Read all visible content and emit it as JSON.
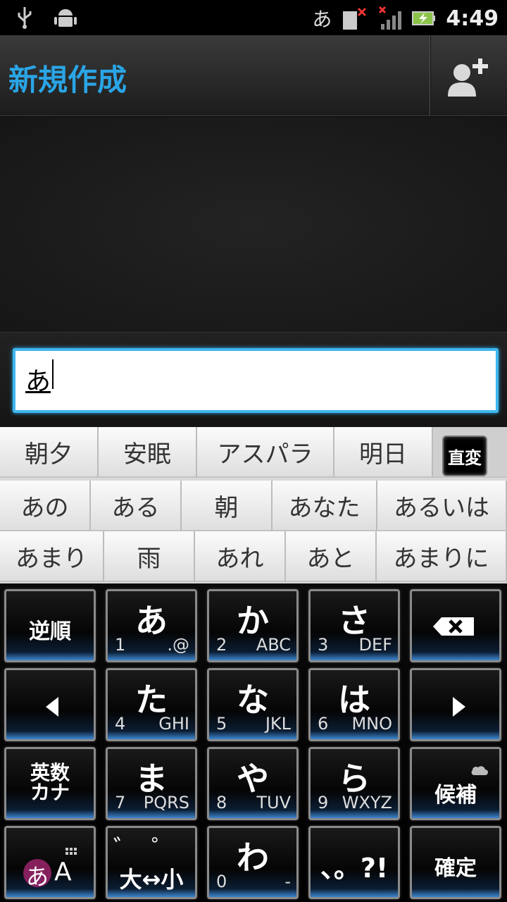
{
  "status_bar": {
    "ime": "あ",
    "time": "4:49",
    "icons": [
      "usb-icon",
      "android-debug-icon",
      "no-sim-icon",
      "no-signal-icon",
      "battery-charging-icon"
    ]
  },
  "title_bar": {
    "title": "新規作成",
    "add_contact_icon": "add-contact-icon"
  },
  "compose": {
    "input_value": "あ"
  },
  "candidates": {
    "row1": [
      "朝夕",
      "安眠",
      "アスパラ",
      "明日"
    ],
    "convert_button": "直変",
    "row2": [
      "あの",
      "ある",
      "朝",
      "あなた",
      "あるいは"
    ],
    "row3": [
      "あまり",
      "雨",
      "あれ",
      "あと",
      "あまりに"
    ]
  },
  "keyboard": {
    "reverse": "逆順",
    "keys": [
      {
        "main": "あ",
        "num": "1",
        "sub": ".@"
      },
      {
        "main": "か",
        "num": "2",
        "sub": "ABC"
      },
      {
        "main": "さ",
        "num": "3",
        "sub": "DEF"
      },
      {
        "main": "た",
        "num": "4",
        "sub": "GHI"
      },
      {
        "main": "な",
        "num": "5",
        "sub": "JKL"
      },
      {
        "main": "は",
        "num": "6",
        "sub": "MNO"
      },
      {
        "main": "ま",
        "num": "7",
        "sub": "PQRS"
      },
      {
        "main": "や",
        "num": "8",
        "sub": "TUV"
      },
      {
        "main": "ら",
        "num": "9",
        "sub": "WXYZ"
      },
      {
        "main": "わ",
        "num": "0",
        "sub": "-"
      }
    ],
    "alnum_kana_line1": "英数",
    "alnum_kana_line2": "カナ",
    "candidates_key": "候補",
    "mode_key_kana": "あ",
    "mode_key_alpha": "A",
    "dakuten": "゛゜",
    "size_toggle": "大↔小",
    "punct": "、。?!",
    "confirm": "確定"
  },
  "colors": {
    "accent": "#2aa5e6",
    "key_glow": "#3d86d0"
  }
}
